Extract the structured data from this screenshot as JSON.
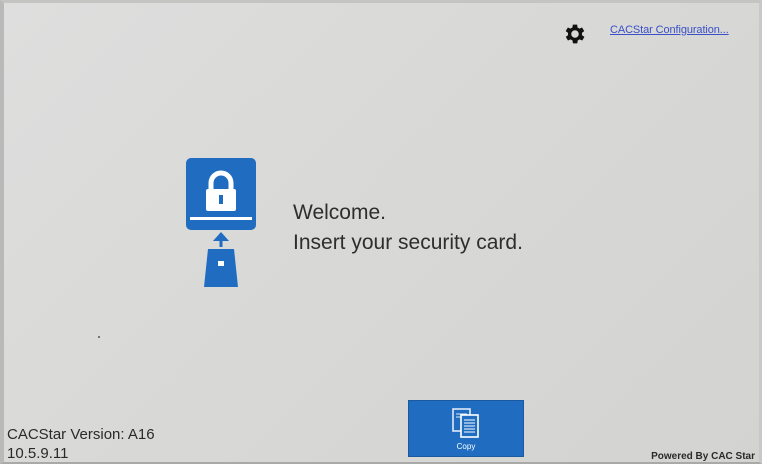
{
  "header": {
    "config_link": "CACStar Configuration...",
    "settings_icon": "gear-icon"
  },
  "main": {
    "welcome_line1": "Welcome.",
    "welcome_line2": "Insert your security card.",
    "card_icon": "security-card-insert-icon"
  },
  "footer": {
    "version_line1": "CACStar Version: A16",
    "version_line2": "10.5.9.11",
    "copy_label": "Copy",
    "copy_icon": "copy-documents-icon",
    "powered_by": "Powered By CAC Star"
  },
  "colors": {
    "accent": "#1f6cc0",
    "link": "#3a4fc8",
    "background": "#dcdcda"
  }
}
